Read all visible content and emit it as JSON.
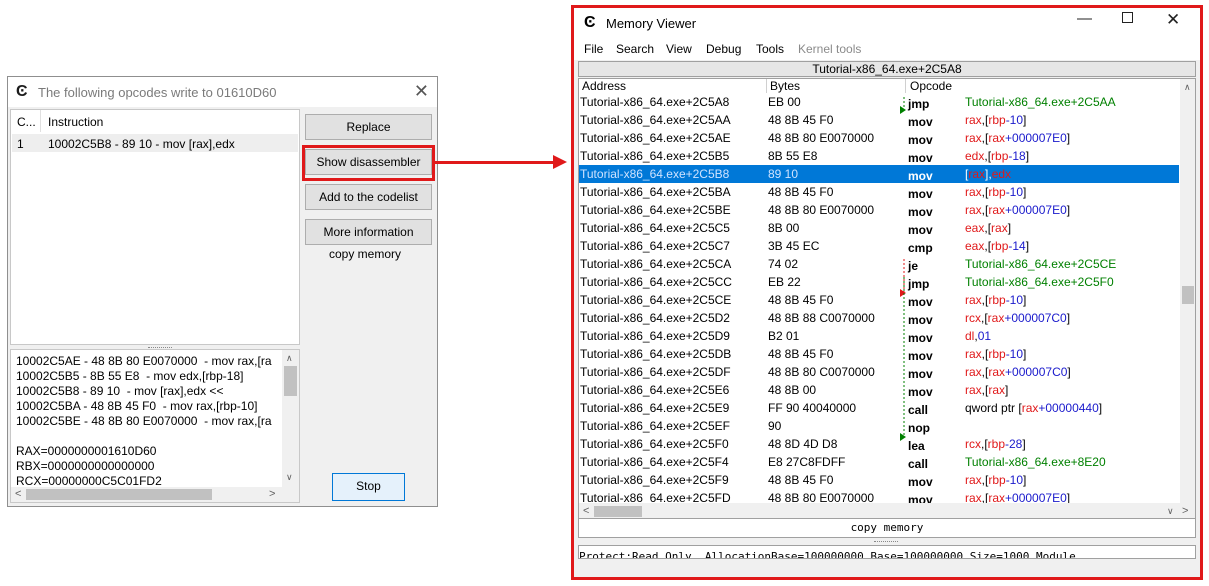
{
  "opcodes_dialog": {
    "title": "The following opcodes write to 01610D60",
    "list": {
      "columns": [
        "C...",
        "Instruction"
      ],
      "rows": [
        {
          "count": "1",
          "instruction": "10002C5B8 - 89 10  - mov [rax],edx"
        }
      ]
    },
    "buttons": {
      "replace": "Replace",
      "show_disassembler": "Show disassembler",
      "add_to_codelist": "Add to the codelist",
      "more_information": "More information",
      "copy_memory": "copy memory",
      "stop": "Stop"
    },
    "details": [
      "10002C5AE - 48 8B 80 E0070000  - mov rax,[ra",
      "10002C5B5 - 8B 55 E8  - mov edx,[rbp-18]",
      "10002C5B8 - 89 10  - mov [rax],edx <<",
      "10002C5BA - 48 8B 45 F0  - mov rax,[rbp-10]",
      "10002C5BE - 48 8B 80 E0070000  - mov rax,[ra",
      "",
      "RAX=0000000001610D60",
      "RBX=0000000000000000",
      "RCX=00000000C5C01FD2"
    ]
  },
  "memory_viewer": {
    "title": "Memory Viewer",
    "menu": [
      "File",
      "Search",
      "View",
      "Debug",
      "Tools",
      "Kernel tools"
    ],
    "address_bar": "Tutorial-x86_64.exe+2C5A8",
    "columns": {
      "address": "Address",
      "bytes": "Bytes",
      "opcode": "Opcode"
    },
    "copy_memory": "copy memory",
    "status": "Protect:Read Only  AllocationBase=100000000 Base=100000000 Size=1000 Module",
    "colors": {
      "register": "#e0191a",
      "number": "#1a1acc",
      "label": "#008000",
      "selection": "#0078d7"
    },
    "rows": [
      {
        "addr": "Tutorial-x86_64.exe+2C5A8",
        "bytes": "EB 00",
        "op": "jmp",
        "parts": [
          [
            "Tutorial-x86_64.exe+2C5AA",
            "lbl"
          ]
        ]
      },
      {
        "addr": "Tutorial-x86_64.exe+2C5AA",
        "bytes": "48 8B 45 F0",
        "op": "mov",
        "parts": [
          [
            "rax",
            "reg"
          ],
          [
            ",[",
            "pl"
          ],
          [
            "rbp",
            "reg"
          ],
          [
            "-10",
            "num"
          ],
          [
            "]",
            "pl"
          ]
        ]
      },
      {
        "addr": "Tutorial-x86_64.exe+2C5AE",
        "bytes": "48 8B 80 E0070000",
        "op": "mov",
        "parts": [
          [
            "rax",
            "reg"
          ],
          [
            ",[",
            "pl"
          ],
          [
            "rax",
            "reg"
          ],
          [
            "+000007E0",
            "num"
          ],
          [
            "]",
            "pl"
          ]
        ]
      },
      {
        "addr": "Tutorial-x86_64.exe+2C5B5",
        "bytes": "8B 55 E8",
        "op": "mov",
        "parts": [
          [
            "edx",
            "reg"
          ],
          [
            ",[",
            "pl"
          ],
          [
            "rbp",
            "reg"
          ],
          [
            "-18",
            "num"
          ],
          [
            "]",
            "pl"
          ]
        ]
      },
      {
        "addr": "Tutorial-x86_64.exe+2C5B8",
        "bytes": "89 10",
        "op": "mov",
        "selected": true,
        "parts": [
          [
            "[",
            "pl"
          ],
          [
            "rax",
            "reg"
          ],
          [
            "],",
            "pl"
          ],
          [
            "edx",
            "reg"
          ]
        ]
      },
      {
        "addr": "Tutorial-x86_64.exe+2C5BA",
        "bytes": "48 8B 45 F0",
        "op": "mov",
        "parts": [
          [
            "rax",
            "reg"
          ],
          [
            ",[",
            "pl"
          ],
          [
            "rbp",
            "reg"
          ],
          [
            "-10",
            "num"
          ],
          [
            "]",
            "pl"
          ]
        ]
      },
      {
        "addr": "Tutorial-x86_64.exe+2C5BE",
        "bytes": "48 8B 80 E0070000",
        "op": "mov",
        "parts": [
          [
            "rax",
            "reg"
          ],
          [
            ",[",
            "pl"
          ],
          [
            "rax",
            "reg"
          ],
          [
            "+000007E0",
            "num"
          ],
          [
            "]",
            "pl"
          ]
        ]
      },
      {
        "addr": "Tutorial-x86_64.exe+2C5C5",
        "bytes": "8B 00",
        "op": "mov",
        "parts": [
          [
            "eax",
            "reg"
          ],
          [
            ",[",
            "pl"
          ],
          [
            "rax",
            "reg"
          ],
          [
            "]",
            "pl"
          ]
        ]
      },
      {
        "addr": "Tutorial-x86_64.exe+2C5C7",
        "bytes": "3B 45 EC",
        "op": "cmp",
        "parts": [
          [
            "eax",
            "reg"
          ],
          [
            ",[",
            "pl"
          ],
          [
            "rbp",
            "reg"
          ],
          [
            "-14",
            "num"
          ],
          [
            "]",
            "pl"
          ]
        ]
      },
      {
        "addr": "Tutorial-x86_64.exe+2C5CA",
        "bytes": "74 02",
        "op": "je",
        "parts": [
          [
            "Tutorial-x86_64.exe+2C5CE",
            "lbl"
          ]
        ]
      },
      {
        "addr": "Tutorial-x86_64.exe+2C5CC",
        "bytes": "EB 22",
        "op": "jmp",
        "parts": [
          [
            "Tutorial-x86_64.exe+2C5F0",
            "lbl"
          ]
        ]
      },
      {
        "addr": "Tutorial-x86_64.exe+2C5CE",
        "bytes": "48 8B 45 F0",
        "op": "mov",
        "parts": [
          [
            "rax",
            "reg"
          ],
          [
            ",[",
            "pl"
          ],
          [
            "rbp",
            "reg"
          ],
          [
            "-10",
            "num"
          ],
          [
            "]",
            "pl"
          ]
        ]
      },
      {
        "addr": "Tutorial-x86_64.exe+2C5D2",
        "bytes": "48 8B 88 C0070000",
        "op": "mov",
        "parts": [
          [
            "rcx",
            "reg"
          ],
          [
            ",[",
            "pl"
          ],
          [
            "rax",
            "reg"
          ],
          [
            "+000007C0",
            "num"
          ],
          [
            "]",
            "pl"
          ]
        ]
      },
      {
        "addr": "Tutorial-x86_64.exe+2C5D9",
        "bytes": "B2 01",
        "op": "mov",
        "parts": [
          [
            "dl",
            "reg"
          ],
          [
            ",",
            "pl"
          ],
          [
            "01",
            "num"
          ]
        ]
      },
      {
        "addr": "Tutorial-x86_64.exe+2C5DB",
        "bytes": "48 8B 45 F0",
        "op": "mov",
        "parts": [
          [
            "rax",
            "reg"
          ],
          [
            ",[",
            "pl"
          ],
          [
            "rbp",
            "reg"
          ],
          [
            "-10",
            "num"
          ],
          [
            "]",
            "pl"
          ]
        ]
      },
      {
        "addr": "Tutorial-x86_64.exe+2C5DF",
        "bytes": "48 8B 80 C0070000",
        "op": "mov",
        "parts": [
          [
            "rax",
            "reg"
          ],
          [
            ",[",
            "pl"
          ],
          [
            "rax",
            "reg"
          ],
          [
            "+000007C0",
            "num"
          ],
          [
            "]",
            "pl"
          ]
        ]
      },
      {
        "addr": "Tutorial-x86_64.exe+2C5E6",
        "bytes": "48 8B 00",
        "op": "mov",
        "parts": [
          [
            "rax",
            "reg"
          ],
          [
            ",[",
            "pl"
          ],
          [
            "rax",
            "reg"
          ],
          [
            "]",
            "pl"
          ]
        ]
      },
      {
        "addr": "Tutorial-x86_64.exe+2C5E9",
        "bytes": "FF 90 40040000",
        "op": "call",
        "parts": [
          [
            "qword ptr [",
            "pl"
          ],
          [
            "rax",
            "reg"
          ],
          [
            "+00000440",
            "num"
          ],
          [
            "]",
            "pl"
          ]
        ]
      },
      {
        "addr": "Tutorial-x86_64.exe+2C5EF",
        "bytes": "90",
        "op": "nop",
        "parts": []
      },
      {
        "addr": "Tutorial-x86_64.exe+2C5F0",
        "bytes": "48 8D 4D D8",
        "op": "lea",
        "parts": [
          [
            "rcx",
            "reg"
          ],
          [
            ",[",
            "pl"
          ],
          [
            "rbp",
            "reg"
          ],
          [
            "-28",
            "num"
          ],
          [
            "]",
            "pl"
          ]
        ]
      },
      {
        "addr": "Tutorial-x86_64.exe+2C5F4",
        "bytes": "E8 27C8FDFF",
        "op": "call",
        "parts": [
          [
            "Tutorial-x86_64.exe+8E20",
            "lbl"
          ]
        ]
      },
      {
        "addr": "Tutorial-x86_64.exe+2C5F9",
        "bytes": "48 8B 45 F0",
        "op": "mov",
        "parts": [
          [
            "rax",
            "reg"
          ],
          [
            ",[",
            "pl"
          ],
          [
            "rbp",
            "reg"
          ],
          [
            "-10",
            "num"
          ],
          [
            "]",
            "pl"
          ]
        ]
      },
      {
        "addr": "Tutorial-x86_64.exe+2C5FD",
        "bytes": "48 8B 80 E0070000",
        "op": "mov",
        "parts": [
          [
            "rax",
            "reg"
          ],
          [
            ",[",
            "pl"
          ],
          [
            "rax",
            "reg"
          ],
          [
            "+000007E0",
            "num"
          ],
          [
            "]",
            "pl"
          ]
        ]
      }
    ]
  }
}
